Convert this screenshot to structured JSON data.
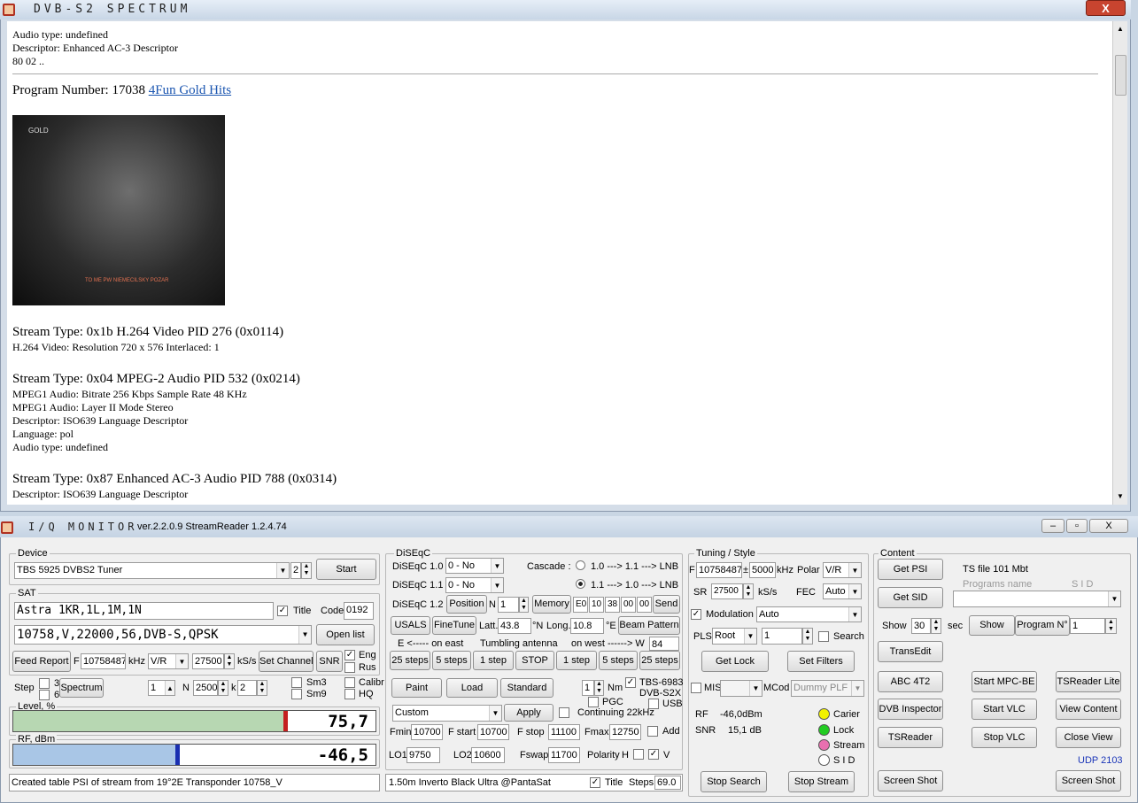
{
  "win1": {
    "title": "DVB-S2  SPECTRUM",
    "close": "X"
  },
  "doc": {
    "l1": "Audio type: undefined",
    "l2": "Descriptor: Enhanced AC-3 Descriptor",
    "l3": "80 02 ..",
    "prog_prefix": "Program Number: 17038",
    "prog_link": "4Fun Gold Hits",
    "s1h": "Stream Type: 0x1b H.264 Video PID 276 (0x0114)",
    "s1a": "H.264 Video: Resolution 720 x 576 Interlaced: 1",
    "s2h": "Stream Type: 0x04 MPEG-2 Audio PID 532 (0x0214)",
    "s2a": "MPEG1 Audio: Bitrate 256 Kbps Sample Rate 48 KHz",
    "s2b": "MPEG1 Audio: Layer II Mode Stereo",
    "s2c": "Descriptor: ISO639 Language Descriptor",
    "s2d": "Language: pol",
    "s2e": "Audio type: undefined",
    "s3h": "Stream Type: 0x87 Enhanced AC-3 Audio PID 788 (0x0314)",
    "s3a": "Descriptor: ISO639 Language Descriptor",
    "video_logo": "GOLD",
    "video_caption": "TO ME PW NIEMECILSKY POZAR"
  },
  "win2": {
    "title": "I/Q  MONITOR",
    "version": "ver.2.2.0.9  StreamReader 1.2.4.74",
    "close": "X"
  },
  "device": {
    "label": "Device",
    "tuner": "TBS 5925 DVBS2 Tuner",
    "num": "2",
    "start": "Start"
  },
  "sat": {
    "label": "SAT",
    "sat_name": "Astra 1KR,1L,1M,1N",
    "title_lbl": "Title",
    "code_lbl": "Code",
    "code": "0192",
    "transponder": "10758,V,22000,56,DVB-S,QPSK",
    "open_list": "Open list",
    "feed_report": "Feed Report",
    "f_lbl": "F",
    "freq": "10758487",
    "khz": "kHz",
    "pol": "V/R",
    "sr": "27500",
    "ksps": "kS/s",
    "set_channel": "Set Channel",
    "snr": "SNR",
    "eng": "Eng",
    "rus": "Rus"
  },
  "step": {
    "label": "Step",
    "v3": "3",
    "v6": "6",
    "spectrum": "Spectrum",
    "one": "1",
    "n": "N",
    "nval": "2500",
    "k": "k",
    "kval": "2",
    "sm3": "Sm3",
    "sm9": "Sm9",
    "calibr": "Calibr",
    "hq": "HQ"
  },
  "level": {
    "label": "Level, %",
    "value": "75,7",
    "fraction": 0.757
  },
  "rf": {
    "label": "RF, dBm",
    "value": "-46,5",
    "fraction": 0.46
  },
  "status": {
    "text": "Created table PSI of stream from  19°2E  Transponder  10758_V"
  },
  "diseqc": {
    "label": "DiSEqC",
    "d10": "DiSEqC 1.0",
    "d10v": "0 - No",
    "d11": "DiSEqC 1.1",
    "d11v": "0 - No",
    "d12": "DiSEqC 1.2",
    "cascade": "Cascade :",
    "c1": "1.0 ---> 1.1 ---> LNB",
    "c2": "1.1 ---> 1.0 ---> LNB",
    "position": "Position",
    "n": "N",
    "nval": "1",
    "memory": "Memory",
    "bytes": [
      "E0",
      "10",
      "38",
      "00",
      "00"
    ],
    "send": "Send",
    "usals": "USALS",
    "finetune": "FineTune",
    "latt": "Latt.",
    "latt_v": "43.8",
    "n_deg": "°N",
    "long": "Long.",
    "long_v": "10.8",
    "e_deg": "°E",
    "beam": "Beam Pattern",
    "east": "E  <-----  on  east",
    "tumbling": "Tumbling antenna",
    "west": "on  west  ------> W",
    "wval": "84",
    "steps": [
      "25 steps",
      "5 steps",
      "1 step",
      "STOP",
      "1 step",
      "5 steps",
      "25 steps"
    ],
    "paint": "Paint",
    "load": "Load",
    "standard": "Standard",
    "nm": "Nm",
    "nmv": "1",
    "tbs": "TBS-6983",
    "dvbs2x": "DVB-S2X",
    "pgc": "PGC",
    "usb": "USB",
    "custom": "Custom",
    "apply": "Apply",
    "cont": "Continuing 22kHz",
    "fmin": "Fmin",
    "fmin_v": "10700",
    "fstart": "F start",
    "fstart_v": "10700",
    "fstop": "F stop",
    "fstop_v": "11100",
    "fmax": "Fmax",
    "fmax_v": "12750",
    "add": "Add",
    "lo1": "LO1",
    "lo1_v": "9750",
    "lo2": "LO2",
    "lo2_v": "10600",
    "fswap": "Fswap",
    "fswap_v": "11700",
    "polarity": "Polarity",
    "h": "H",
    "v": "V",
    "antenna": "1.50m  Inverto Black Ultra @PantaSat",
    "title_lbl": "Title",
    "steps_lbl": "Steps",
    "steps_v": "69.0"
  },
  "tuning": {
    "label": "Tuning / Style",
    "f": "F",
    "freq": "10758487",
    "pm": "±",
    "bw": "5000",
    "khz": "kHz",
    "polar": "Polar",
    "polv": "V/R",
    "sr": "SR",
    "srv": "27500",
    "ksps": "kS/s",
    "fec": "FEC",
    "fecv": "Auto",
    "modulation": "Modulation",
    "modv": "Auto",
    "pls": "PLS",
    "plsv": "Root",
    "plsn": "1",
    "search": "Search",
    "getlock": "Get Lock",
    "setfilters": "Set Filters",
    "mis": "MIS",
    "mcod": "MCod",
    "dummy": "Dummy PLF",
    "rf": "RF",
    "rfv": "-46,0dBm",
    "snr": "SNR",
    "snrv": "15,1 dB",
    "carier": "Carier",
    "lock": "Lock",
    "stream": "Stream",
    "sid": "S I D",
    "stopsearch": "Stop Search",
    "stopstream": "Stop Stream",
    "colors": {
      "carier": "#f2f200",
      "lock": "#22cc22",
      "stream": "#e870b0",
      "sid": "#ffffff"
    }
  },
  "content": {
    "label": "Content",
    "getpsi": "Get  PSI",
    "tsfile": "TS file  101 Mbt",
    "prognames": "Programs  name",
    "sid": "S I D",
    "getsid": "Get  SID",
    "show": "Show",
    "showv": "30",
    "sec": "sec",
    "showbtn": "Show",
    "program": "Program  N°",
    "programv": "1",
    "transedit": "TransEdit",
    "abc": "ABC 4T2",
    "startmpc": "Start  MPC-BE",
    "tsreaderlite": "TSReader Lite",
    "dvbinspector": "DVB Inspector",
    "startvlc": "Start  VLC",
    "viewcontent": "View Content",
    "tsreader": "TSReader",
    "stopvlc": "Stop  VLC",
    "closeview": "Close View",
    "udp": "UDP 2103",
    "screenshot1": "Screen Shot",
    "screenshot2": "Screen Shot"
  }
}
